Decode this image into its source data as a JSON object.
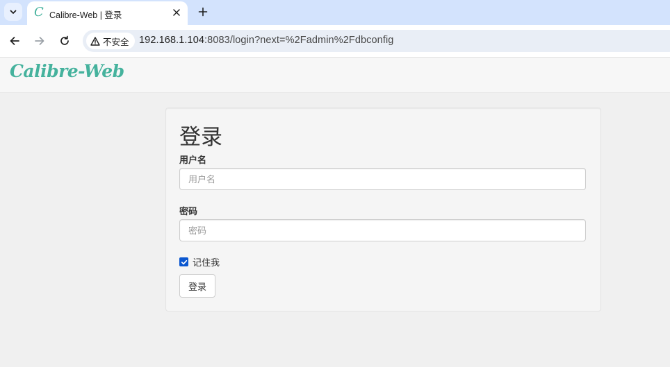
{
  "browser": {
    "tab_title": "Calibre-Web | 登录",
    "favicon_glyph": "C",
    "security_label": "不安全",
    "url_host": "192.168.1.104",
    "url_rest": ":8083/login?next=%2Fadmin%2Fdbconfig"
  },
  "app": {
    "brand": "Calibre-Web",
    "brand_color": "#45b29d"
  },
  "login": {
    "heading": "登录",
    "username_label": "用户名",
    "username_placeholder": "用户名",
    "username_value": "",
    "password_label": "密码",
    "password_placeholder": "密码",
    "password_value": "",
    "remember_label": "记住我",
    "remember_checked": true,
    "submit_label": "登录"
  },
  "icons": {
    "tab_search": "chevron-down-icon",
    "tab_close": "close-icon",
    "new_tab": "plus-icon",
    "back": "arrow-left-icon",
    "forward": "arrow-right-icon",
    "reload": "reload-icon",
    "security": "warning-icon"
  }
}
